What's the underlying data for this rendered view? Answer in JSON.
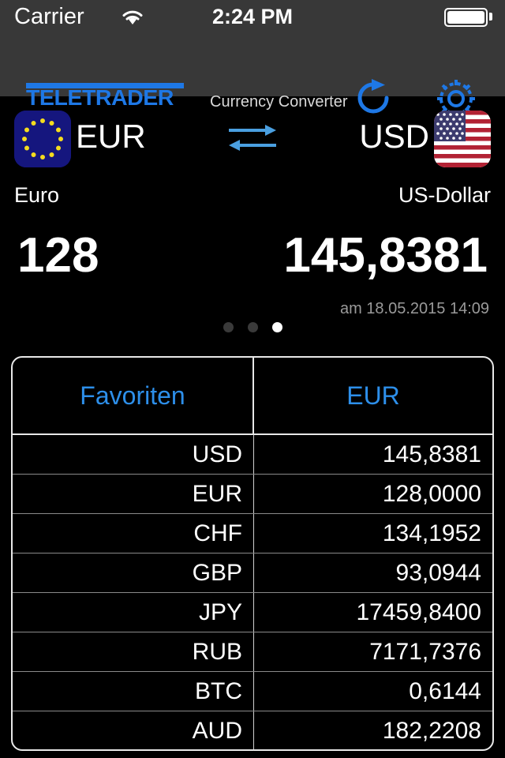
{
  "statusbar": {
    "carrier": "Carrier",
    "time": "2:24 PM",
    "wifi_icon": "wifi-icon",
    "battery_icon": "battery-full-icon"
  },
  "navbar": {
    "logo_text": "TELETRADER",
    "title": "Currency Converter",
    "refresh_icon": "refresh-icon",
    "settings_icon": "gear-icon",
    "accent_color": "#1E78E6"
  },
  "converter": {
    "from": {
      "code": "EUR",
      "name": "Euro",
      "value": "128",
      "flag_icon": "eu-flag-icon"
    },
    "to": {
      "code": "USD",
      "name": "US-Dollar",
      "value": "145,8381",
      "flag_icon": "us-flag-icon"
    },
    "swap_icon": "swap-arrows-icon",
    "timestamp": "am 18.05.2015 14:09",
    "page_dots": {
      "count": 3,
      "active_index": 2
    }
  },
  "table": {
    "headers": [
      "Favoriten",
      "EUR"
    ],
    "rows": [
      {
        "code": "USD",
        "rate": "145,8381"
      },
      {
        "code": "EUR",
        "rate": "128,0000"
      },
      {
        "code": "CHF",
        "rate": "134,1952"
      },
      {
        "code": "GBP",
        "rate": "93,0944"
      },
      {
        "code": "JPY",
        "rate": "17459,8400"
      },
      {
        "code": "RUB",
        "rate": "7171,7376"
      },
      {
        "code": "BTC",
        "rate": "0,6144"
      },
      {
        "code": "AUD",
        "rate": "182,2208"
      }
    ]
  },
  "colors": {
    "accent_blue": "#1E78E6",
    "header_blue": "#2D8FEA",
    "navbar_bg": "#383838",
    "page_bg": "#000000",
    "timestamp_gray": "#9a9a9a"
  }
}
